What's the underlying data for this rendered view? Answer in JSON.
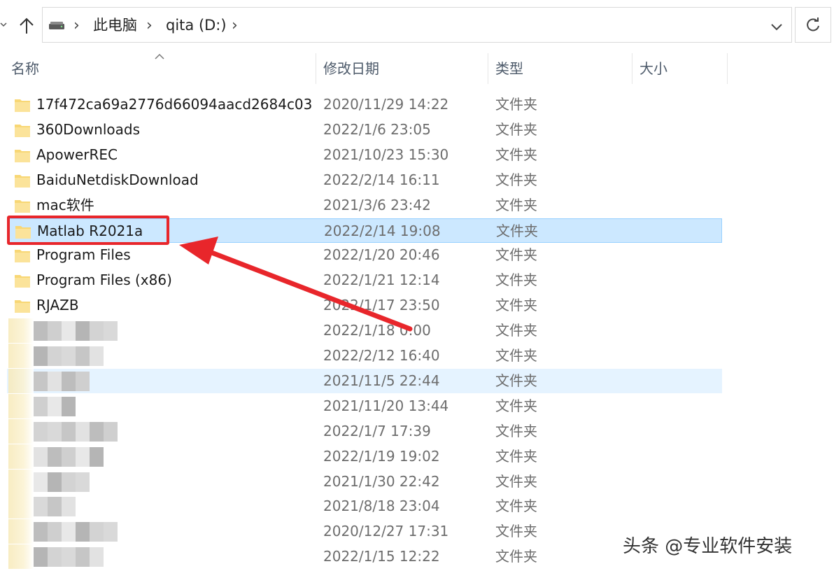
{
  "address_bar": {
    "breadcrumbs": [
      "此电脑",
      "qita (D:)"
    ]
  },
  "columns": {
    "name": "名称",
    "date_modified": "修改日期",
    "type": "类型",
    "size": "大小"
  },
  "files": [
    {
      "name": "17f472ca69a2776d66094aacd2684c03",
      "date": "2020/11/29 14:22",
      "type": "文件夹"
    },
    {
      "name": "360Downloads",
      "date": "2022/1/6 23:05",
      "type": "文件夹"
    },
    {
      "name": "ApowerREC",
      "date": "2021/10/23 15:30",
      "type": "文件夹"
    },
    {
      "name": "BaiduNetdiskDownload",
      "date": "2022/2/14 16:11",
      "type": "文件夹"
    },
    {
      "name": "mac软件",
      "date": "2021/3/6 23:42",
      "type": "文件夹"
    },
    {
      "name": "Matlab R2021a",
      "date": "2022/2/14 19:08",
      "type": "文件夹",
      "selected": true
    },
    {
      "name": "Program Files",
      "date": "2022/1/20 20:46",
      "type": "文件夹"
    },
    {
      "name": "Program Files (x86)",
      "date": "2022/1/21 12:14",
      "type": "文件夹"
    },
    {
      "name": "RJAZB",
      "date": "2022/1/17 23:50",
      "type": "文件夹"
    },
    {
      "name": "",
      "date": "2022/1/18 0:00",
      "type": "文件夹",
      "blurred": true
    },
    {
      "name": "",
      "date": "2022/2/12 16:40",
      "type": "文件夹",
      "blurred": true
    },
    {
      "name": "",
      "date": "2021/11/5 22:44",
      "type": "文件夹",
      "blurred": true,
      "hover": true
    },
    {
      "name": "",
      "date": "2021/11/20 13:44",
      "type": "文件夹",
      "blurred": true
    },
    {
      "name": "",
      "date": "2022/1/7 17:39",
      "type": "文件夹",
      "blurred": true
    },
    {
      "name": "",
      "date": "2022/1/19 19:02",
      "type": "文件夹",
      "blurred": true
    },
    {
      "name": "",
      "date": "2021/1/30 22:42",
      "type": "文件夹",
      "blurred": true
    },
    {
      "name": "",
      "date": "2021/8/18 23:04",
      "type": "文件夹",
      "blurred": true
    },
    {
      "name": "",
      "date": "2020/12/27 17:31",
      "type": "文件夹",
      "blurred": true
    },
    {
      "name": "",
      "date": "2022/1/15 12:22",
      "type": "文件夹",
      "blurred": true
    }
  ],
  "colors": {
    "selection_bg": "#cce8ff",
    "selection_border": "#99d1ff",
    "annotation_red": "#e8262b",
    "folder_yellow": "#f8d775"
  },
  "watermark": "头条 @专业软件安装"
}
